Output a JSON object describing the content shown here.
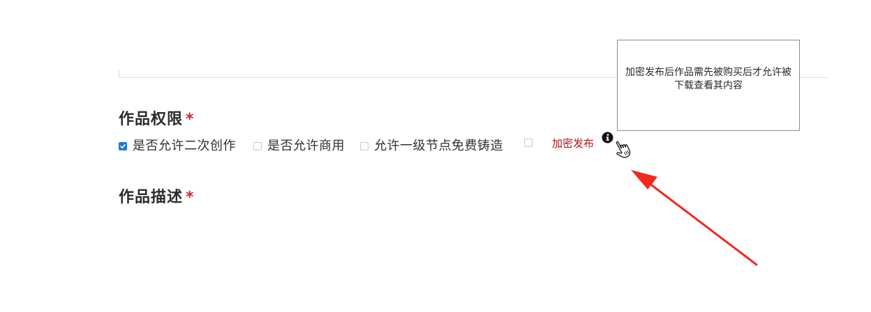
{
  "permissions": {
    "title": "作品权限",
    "required_mark": "*",
    "options": [
      {
        "label": "是否允许二次创作",
        "checked": true
      },
      {
        "label": "是否允许商用",
        "checked": false
      },
      {
        "label": "允许一级节点免费铸造",
        "checked": false
      },
      {
        "label": "",
        "checked": false
      }
    ],
    "encrypt_label": "加密发布",
    "info_icon": "info-icon",
    "tooltip": "加密发布后作品需先被购买后才允许被下载查看其内容"
  },
  "description": {
    "title": "作品描述",
    "required_mark": "*"
  },
  "colors": {
    "accent": "#1f7ae0",
    "required": "#e02020",
    "encrypt_label": "#b0141c",
    "annotation_arrow": "#f02a1e"
  }
}
